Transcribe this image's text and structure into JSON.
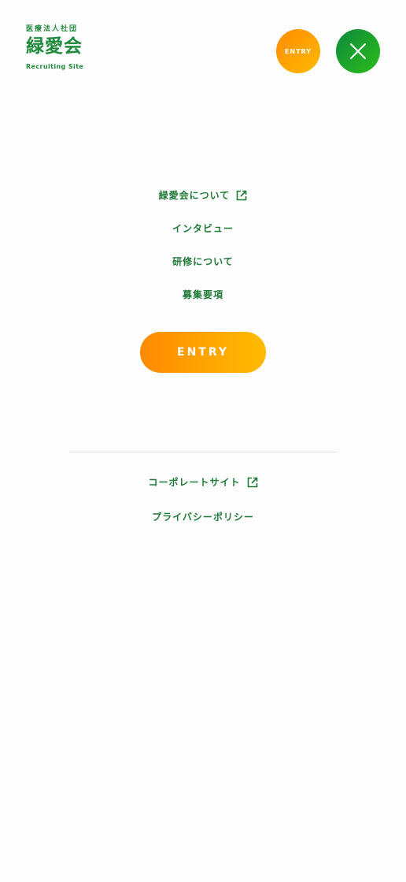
{
  "header": {
    "logo_sub": "医療法人社団",
    "logo_main": "緑愛会",
    "logo_tag": "Recruiting Site",
    "entry_label": "ENTRY",
    "close_icon": "close-icon"
  },
  "menu": {
    "items": [
      {
        "label": "緑愛会について",
        "icon": "external-link-icon"
      },
      {
        "label": "インタビュー"
      },
      {
        "label": "研修について"
      },
      {
        "label": "募集要項"
      }
    ],
    "entry_label": "ENTRY"
  },
  "sub_menu": {
    "items": [
      {
        "label": "コーポレートサイト",
        "icon": "external-link-icon"
      },
      {
        "label": "プライバシーポリシー"
      }
    ]
  },
  "colors": {
    "brand_green": "#1f7a37",
    "orange_start": "#ff8a00",
    "orange_end": "#ffbb00",
    "green_start": "#0d8a3c",
    "green_end": "#2bbd1a",
    "background": "#fdfdfe"
  }
}
